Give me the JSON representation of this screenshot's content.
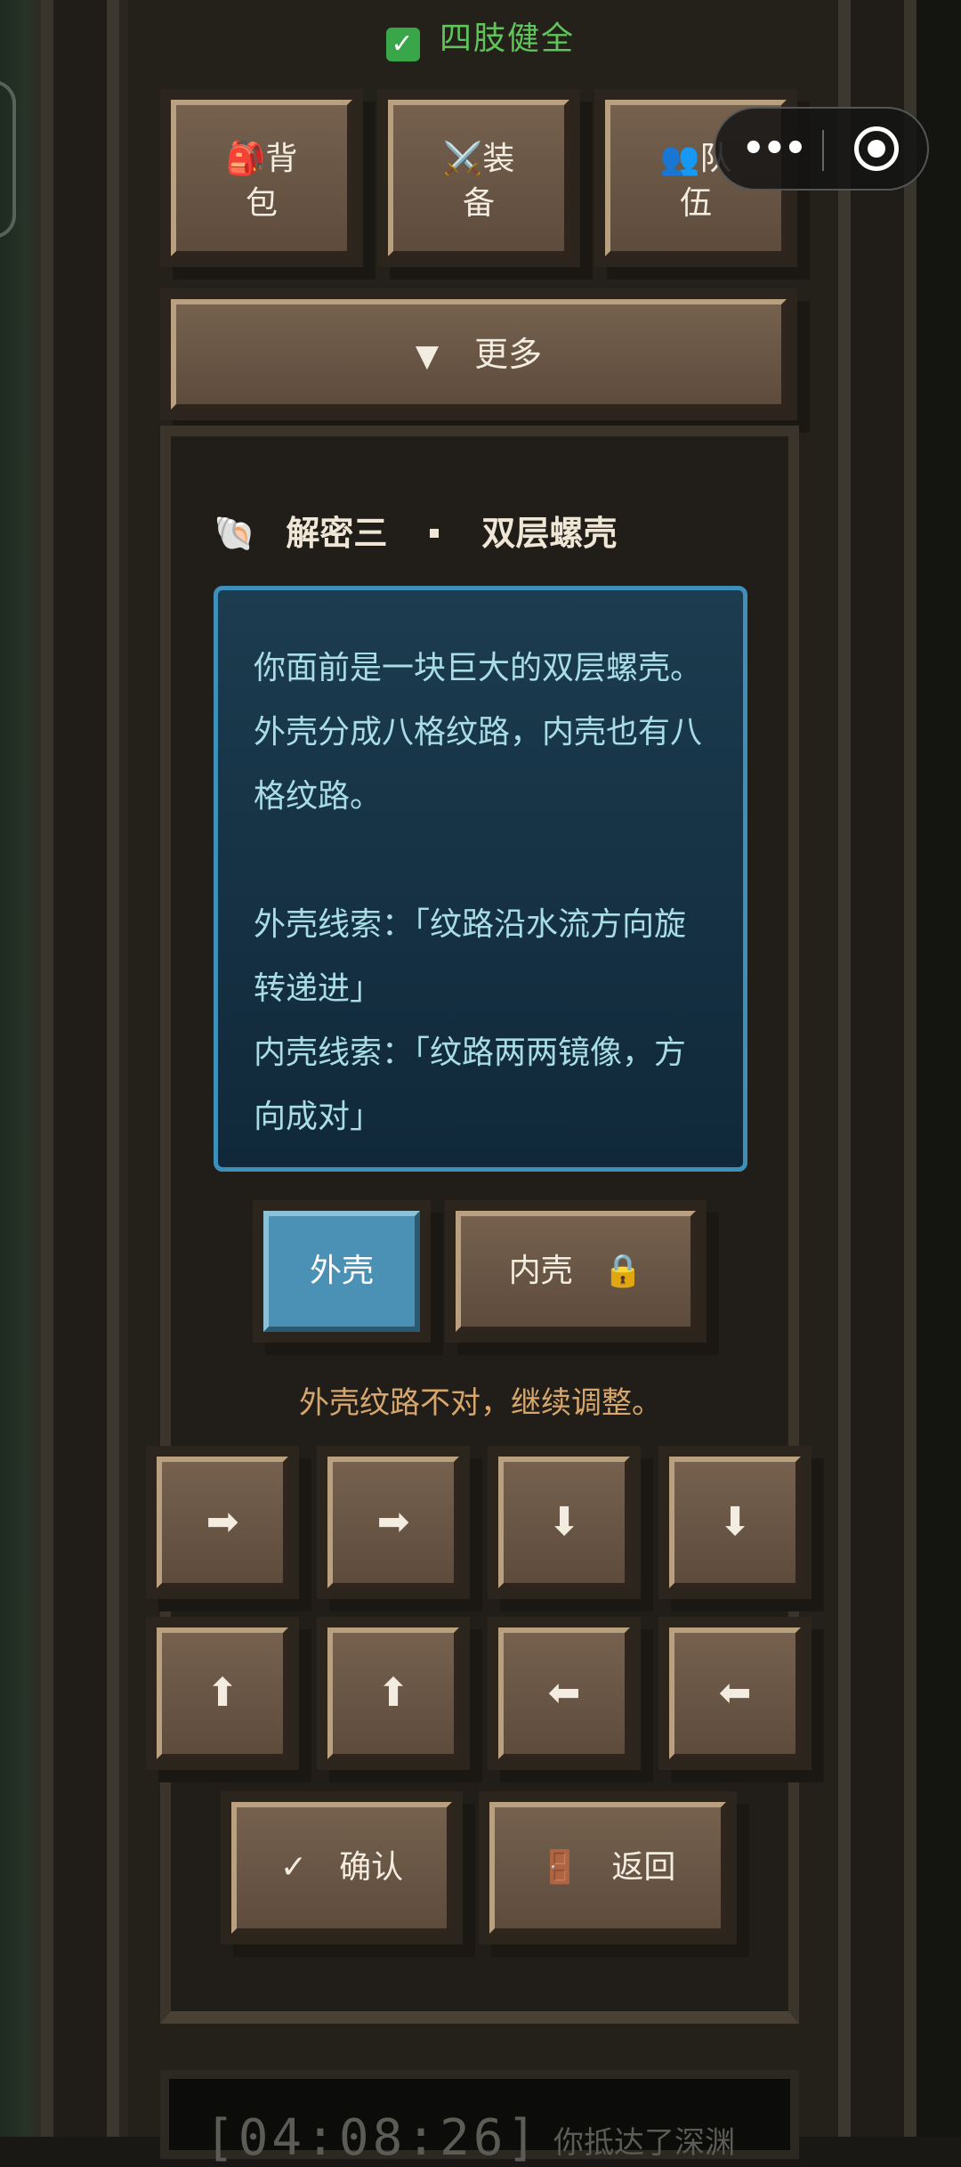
{
  "status": {
    "text": "四肢健全"
  },
  "menu": [
    {
      "icon": "🎒",
      "line1": "背",
      "line2": "包"
    },
    {
      "icon": "⚔️",
      "line1": "装",
      "line2": "备"
    },
    {
      "icon": "👥",
      "line1": "队",
      "line2": "伍"
    }
  ],
  "more": {
    "label": "更多"
  },
  "puzzle": {
    "title_prefix": "解密三",
    "title_suffix": "双层螺壳",
    "description": [
      "你面前是一块巨大的双层螺壳。",
      "外壳分成八格纹路，内壳也有八",
      "格纹路。",
      "",
      "外壳线索：「纹路沿水流方向旋",
      "转递进」",
      "内壳线索：「纹路两两镜像，方",
      "向成对」"
    ],
    "tabs": [
      {
        "label": "外壳",
        "locked": false
      },
      {
        "label": "内壳",
        "locked": true
      }
    ],
    "hint": "外壳纹路不对，继续调整。",
    "arrows": [
      "right",
      "right",
      "down",
      "down",
      "up",
      "up",
      "left",
      "left"
    ],
    "confirm_label": "确认",
    "back_label": "返回"
  },
  "log": {
    "time": "[04:08:26]",
    "text": "你抵达了深渊"
  },
  "colors": {
    "accent": "#4a91b5",
    "status": "#5fc45a",
    "hint": "#d7a66c"
  }
}
